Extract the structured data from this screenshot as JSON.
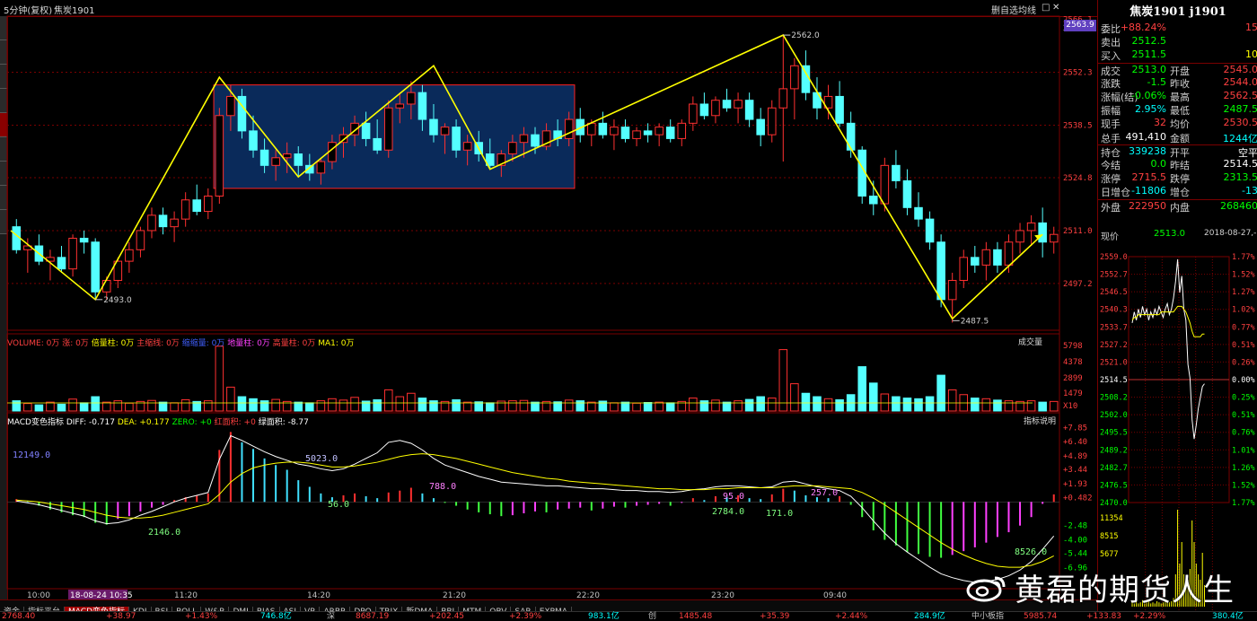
{
  "topbar": {
    "period": "5分钟(复权)",
    "contract": "焦炭1901",
    "right_tools": [
      "删自选",
      "均线",
      "□",
      "✕"
    ]
  },
  "right_axis_labels": [
    "2566.1",
    "2563.9",
    "2552.3",
    "2538.5",
    "2524.8",
    "2511.0",
    "2497.2"
  ],
  "volume_axis_labels": [
    "5798",
    "4378",
    "2899",
    "1479",
    "X10"
  ],
  "macd_axis_labels": [
    "+7.85",
    "+6.40",
    "+4.89",
    "+3.44",
    "+1.93",
    "+0.482",
    "-2.48",
    "-4.00",
    "-5.44",
    "-6.96"
  ],
  "time_axis_labels": [
    "10:00",
    "18-08-24 10:35",
    "11:20",
    "14:20",
    "21:20",
    "22:20",
    "23:20",
    "09:40"
  ],
  "volume_pane": {
    "legend": [
      "VOLUME: 0万",
      "涨: 0万",
      "倍量柱: 0万",
      "主缩线: 0万",
      "缩缩量: 0万",
      "地量柱: 0万",
      "高量柱: 0万",
      "MA1: 0万"
    ],
    "button": "成交量"
  },
  "macd_pane": {
    "legend": [
      "MACD变色指标 DIFF: -0.717",
      "DEA: +0.177",
      "ZERO: +0",
      "红面积: +0",
      "绿面积: -8.77"
    ],
    "button": "指标说明",
    "annotations": [
      "12149.0",
      "2146.0",
      "56.0",
      "5023.0",
      "788.0",
      "2784.0",
      "95.0",
      "171.0",
      "257.0",
      "8526.0"
    ]
  },
  "price_labels": {
    "low1": "2493.0",
    "high": "2562.0",
    "low2": "2487.5"
  },
  "quote": {
    "title": "焦炭1901 j1901",
    "current_price_tag": "2563.9",
    "rows": [
      {
        "k": "委比",
        "v1": "+88.24%",
        "c1": "#ff4040",
        "k2": "",
        "v2": "15",
        "c2": "#ff4040"
      },
      {
        "k": "卖出",
        "v1": "2512.5",
        "c1": "#00ff00",
        "k2": "",
        "v2": "",
        "c2": "#ff4040"
      },
      {
        "k": "买入",
        "v1": "2511.5",
        "c1": "#00ff00",
        "k2": "",
        "v2": "10",
        "c2": "#ffff00"
      },
      {
        "k": "成交",
        "v1": "2513.0",
        "c1": "#00ff00",
        "k2": "开盘",
        "v2": "2545.0",
        "c2": "#ff4040"
      },
      {
        "k": "涨跌",
        "v1": "-1.5",
        "c1": "#00ff00",
        "k2": "昨收",
        "v2": "2544.0",
        "c2": "#ff4040"
      },
      {
        "k": "涨幅(结)",
        "v1": "-0.06%",
        "c1": "#00ff00",
        "k2": "最高",
        "v2": "2562.5",
        "c2": "#ff4040"
      },
      {
        "k": "振幅",
        "v1": "2.95%",
        "c1": "#00ffff",
        "k2": "最低",
        "v2": "2487.5",
        "c2": "#00ff00"
      },
      {
        "k": "现手",
        "v1": "32",
        "c1": "#ff4040",
        "k2": "均价",
        "v2": "2530.5",
        "c2": "#ff4040"
      },
      {
        "k": "总手",
        "v1": "491,410",
        "c1": "#ffffff",
        "k2": "金额",
        "v2": "1244亿",
        "c2": "#00ffff"
      },
      {
        "k": "持仓",
        "v1": "339238",
        "c1": "#00ffff",
        "k2": "开平",
        "v2": "空平",
        "c2": "#ffffff"
      },
      {
        "k": "今结",
        "v1": "0.0",
        "c1": "#00ff00",
        "k2": "昨结",
        "v2": "2514.5",
        "c2": "#ffffff"
      },
      {
        "k": "涨停",
        "v1": "2715.5",
        "c1": "#ff4040",
        "k2": "跌停",
        "v2": "2313.5",
        "c2": "#00ff00"
      },
      {
        "k": "日增仓",
        "v1": "-11806",
        "c1": "#00ffff",
        "k2": "增仓",
        "v2": "-13",
        "c2": "#00ffff"
      },
      {
        "k": "外盘",
        "v1": "222950",
        "c1": "#ff4040",
        "k2": "内盘",
        "v2": "268460",
        "c2": "#00ff00"
      }
    ],
    "now_label": "现价",
    "now_price": "2513.0",
    "now_time": "2018-08-27,-",
    "mini_left_labels": [
      "2559.0",
      "2552.7",
      "2546.5",
      "2540.3",
      "2533.7",
      "2527.2",
      "2521.0",
      "2514.5",
      "2508.2",
      "2502.0",
      "2495.5",
      "2489.2",
      "2482.7",
      "2476.5",
      "2470.0",
      "11354",
      "8515",
      "5677"
    ],
    "mini_right_labels": [
      "1.77%",
      "1.52%",
      "1.27%",
      "1.02%",
      "0.77%",
      "0.51%",
      "0.26%",
      "0.00%",
      "0.25%",
      "0.51%",
      "0.76%",
      "1.01%",
      "1.26%",
      "1.52%",
      "1.77%"
    ]
  },
  "tabs": [
    "资金",
    "指标平台",
    "MACD变色指标",
    "KDJ",
    "RSI",
    "BOLL",
    "W&R",
    "DMI",
    "BIAS",
    "ASI",
    "VR",
    "ARBR",
    "DPO",
    "TRIX",
    "新DMA",
    "BBI",
    "MTM",
    "OBV",
    "SAR",
    "EXPMA"
  ],
  "status": [
    {
      "t": "2768.40",
      "c": "#ff4040"
    },
    {
      "t": "+38.97",
      "c": "#ff4040"
    },
    {
      "t": "+1.43%",
      "c": "#ff4040"
    },
    {
      "t": "746.8亿",
      "c": "#00ffff"
    },
    {
      "t": "深",
      "c": "#c0c0c0"
    },
    {
      "t": "8687.19",
      "c": "#ff4040"
    },
    {
      "t": "+202.45",
      "c": "#ff4040"
    },
    {
      "t": "+2.39%",
      "c": "#ff4040"
    },
    {
      "t": "983.1亿",
      "c": "#00ffff"
    },
    {
      "t": "创",
      "c": "#c0c0c0"
    },
    {
      "t": "1485.48",
      "c": "#ff4040"
    },
    {
      "t": "+35.39",
      "c": "#ff4040"
    },
    {
      "t": "+2.44%",
      "c": "#ff4040"
    },
    {
      "t": "284.9亿",
      "c": "#00ffff"
    },
    {
      "t": "中小板指",
      "c": "#c0c0c0"
    },
    {
      "t": "5985.74",
      "c": "#ff4040"
    },
    {
      "t": "+133.83",
      "c": "#ff4040"
    },
    {
      "t": "+2.29%",
      "c": "#ff4040"
    },
    {
      "t": "380.4亿",
      "c": "#00ffff"
    }
  ],
  "watermark": "黄磊的期货人生",
  "colors": {
    "up": "#ff3030",
    "down": "#54ffff",
    "zigzag": "#ffff00",
    "box_fill": "#0a2a5a",
    "box_border": "#ff2020",
    "grid": "#7a0000"
  },
  "chart_data": {
    "type": "candlestick",
    "ylim": [
      2485,
      2566
    ],
    "ohlc": [
      [
        2512,
        2514,
        2505,
        2506
      ],
      [
        2506,
        2509,
        2500,
        2507
      ],
      [
        2507,
        2510,
        2502,
        2503
      ],
      [
        2503,
        2506,
        2498,
        2504
      ],
      [
        2504,
        2507,
        2500,
        2501
      ],
      [
        2501,
        2510,
        2499,
        2509
      ],
      [
        2509,
        2511,
        2505,
        2508
      ],
      [
        2508,
        2509,
        2493,
        2495
      ],
      [
        2495,
        2499,
        2493,
        2498
      ],
      [
        2498,
        2504,
        2496,
        2503
      ],
      [
        2503,
        2508,
        2500,
        2506
      ],
      [
        2506,
        2512,
        2504,
        2511
      ],
      [
        2511,
        2517,
        2509,
        2515
      ],
      [
        2515,
        2517,
        2510,
        2512
      ],
      [
        2512,
        2516,
        2508,
        2514
      ],
      [
        2514,
        2521,
        2512,
        2519
      ],
      [
        2519,
        2523,
        2515,
        2516
      ],
      [
        2516,
        2522,
        2514,
        2520
      ],
      [
        2520,
        2543,
        2518,
        2541
      ],
      [
        2541,
        2549,
        2537,
        2546
      ],
      [
        2546,
        2548,
        2535,
        2537
      ],
      [
        2537,
        2541,
        2530,
        2532
      ],
      [
        2532,
        2535,
        2526,
        2528
      ],
      [
        2528,
        2532,
        2524,
        2530
      ],
      [
        2530,
        2534,
        2526,
        2531
      ],
      [
        2531,
        2533,
        2525,
        2528
      ],
      [
        2528,
        2531,
        2524,
        2526
      ],
      [
        2526,
        2530,
        2523,
        2529
      ],
      [
        2529,
        2536,
        2527,
        2534
      ],
      [
        2534,
        2538,
        2530,
        2536
      ],
      [
        2536,
        2541,
        2533,
        2539
      ],
      [
        2539,
        2542,
        2533,
        2535
      ],
      [
        2535,
        2540,
        2531,
        2532
      ],
      [
        2532,
        2545,
        2530,
        2543
      ],
      [
        2543,
        2547,
        2539,
        2544
      ],
      [
        2544,
        2550,
        2540,
        2547
      ],
      [
        2547,
        2549,
        2537,
        2540
      ],
      [
        2540,
        2544,
        2534,
        2536
      ],
      [
        2536,
        2539,
        2531,
        2538
      ],
      [
        2538,
        2540,
        2530,
        2532
      ],
      [
        2532,
        2536,
        2528,
        2534
      ],
      [
        2534,
        2537,
        2529,
        2531
      ],
      [
        2531,
        2535,
        2527,
        2528
      ],
      [
        2528,
        2532,
        2525,
        2531
      ],
      [
        2531,
        2536,
        2529,
        2534
      ],
      [
        2534,
        2538,
        2530,
        2536
      ],
      [
        2536,
        2538,
        2531,
        2533
      ],
      [
        2533,
        2539,
        2532,
        2537
      ],
      [
        2537,
        2540,
        2533,
        2535
      ],
      [
        2535,
        2542,
        2533,
        2540
      ],
      [
        2540,
        2543,
        2534,
        2536
      ],
      [
        2536,
        2540,
        2533,
        2539
      ],
      [
        2539,
        2542,
        2535,
        2536
      ],
      [
        2536,
        2540,
        2532,
        2538
      ],
      [
        2538,
        2540,
        2534,
        2535
      ],
      [
        2535,
        2538,
        2533,
        2537
      ],
      [
        2537,
        2539,
        2534,
        2536
      ],
      [
        2536,
        2539,
        2533,
        2538
      ],
      [
        2538,
        2540,
        2534,
        2535
      ],
      [
        2535,
        2540,
        2533,
        2539
      ],
      [
        2539,
        2546,
        2537,
        2544
      ],
      [
        2544,
        2547,
        2540,
        2541
      ],
      [
        2541,
        2546,
        2539,
        2545
      ],
      [
        2545,
        2548,
        2542,
        2543
      ],
      [
        2543,
        2547,
        2539,
        2545
      ],
      [
        2545,
        2547,
        2538,
        2540
      ],
      [
        2540,
        2543,
        2533,
        2536
      ],
      [
        2536,
        2545,
        2534,
        2543
      ],
      [
        2543,
        2562,
        2529,
        2548
      ],
      [
        2548,
        2556,
        2540,
        2554
      ],
      [
        2554,
        2558,
        2545,
        2547
      ],
      [
        2547,
        2551,
        2540,
        2543
      ],
      [
        2543,
        2549,
        2540,
        2546
      ],
      [
        2546,
        2550,
        2538,
        2539
      ],
      [
        2539,
        2542,
        2530,
        2532
      ],
      [
        2532,
        2533,
        2518,
        2520
      ],
      [
        2520,
        2524,
        2515,
        2518
      ],
      [
        2518,
        2530,
        2516,
        2528
      ],
      [
        2528,
        2532,
        2522,
        2524
      ],
      [
        2524,
        2527,
        2515,
        2517
      ],
      [
        2517,
        2521,
        2512,
        2514
      ],
      [
        2514,
        2516,
        2506,
        2508
      ],
      [
        2508,
        2510,
        2491,
        2493
      ],
      [
        2493,
        2500,
        2487,
        2498
      ],
      [
        2498,
        2506,
        2496,
        2504
      ],
      [
        2504,
        2507,
        2500,
        2502
      ],
      [
        2502,
        2508,
        2498,
        2506
      ],
      [
        2506,
        2508,
        2500,
        2502
      ],
      [
        2502,
        2510,
        2500,
        2508
      ],
      [
        2508,
        2513,
        2505,
        2511
      ],
      [
        2511,
        2515,
        2507,
        2513
      ],
      [
        2513,
        2517,
        2504,
        2508
      ],
      [
        2508,
        2512,
        2505,
        2510
      ]
    ],
    "price_zigzag": [
      [
        0,
        2511
      ],
      [
        7,
        2493
      ],
      [
        18,
        2551
      ],
      [
        25,
        2525
      ],
      [
        37,
        2554
      ],
      [
        42,
        2527
      ],
      [
        68,
        2562
      ],
      [
        83,
        2488
      ],
      [
        91,
        2510
      ]
    ],
    "volume": [
      300,
      220,
      180,
      260,
      200,
      350,
      240,
      420,
      260,
      300,
      230,
      280,
      310,
      260,
      240,
      330,
      280,
      300,
      1900,
      700,
      420,
      360,
      300,
      340,
      280,
      260,
      240,
      300,
      360,
      320,
      400,
      290,
      330,
      620,
      420,
      520,
      380,
      300,
      280,
      330,
      260,
      270,
      240,
      290,
      300,
      310,
      260,
      280,
      270,
      320,
      300,
      260,
      290,
      240,
      260,
      230,
      250,
      260,
      240,
      280,
      380,
      300,
      320,
      260,
      300,
      340,
      420,
      380,
      1800,
      800,
      520,
      420,
      360,
      330,
      480,
      1300,
      820,
      500,
      420,
      380,
      360,
      420,
      1050,
      620,
      480,
      380,
      360,
      320,
      300,
      280,
      300,
      260,
      280
    ],
    "macd": [
      0.3,
      0.1,
      -0.4,
      -0.8,
      -1.1,
      -1.4,
      -1.6,
      -2.2,
      -2.4,
      -1.8,
      -1.5,
      -1.0,
      -0.6,
      -0.3,
      0.2,
      0.5,
      0.7,
      0.9,
      5.5,
      7.4,
      6.3,
      5.6,
      4.6,
      3.9,
      3.4,
      2.3,
      1.6,
      0.9,
      0.5,
      0.7,
      0.9,
      0.6,
      0.4,
      1.0,
      1.2,
      1.5,
      0.9,
      0.4,
      -0.1,
      -0.4,
      -0.8,
      -1.1,
      -1.3,
      -1.5,
      -1.4,
      -1.2,
      -1.0,
      -1.1,
      -0.8,
      -0.7,
      -0.6,
      -0.9,
      -0.7,
      -0.5,
      -0.6,
      -0.4,
      -0.3,
      -0.2,
      -0.4,
      -0.1,
      0.4,
      0.2,
      0.6,
      0.5,
      0.7,
      0.4,
      0.3,
      0.8,
      1.4,
      1.2,
      0.7,
      0.5,
      0.4,
      0.6,
      -0.3,
      -1.6,
      -3.0,
      -4.0,
      -4.6,
      -5.3,
      -5.5,
      -5.8,
      -5.9,
      -5.6,
      -5.2,
      -4.8,
      -4.3,
      -3.7,
      -3.2,
      -2.5,
      -1.6,
      -0.2,
      0.8
    ],
    "diff": [
      0.1,
      -0.1,
      -0.3,
      -0.6,
      -0.9,
      -1.2,
      -1.5,
      -2.0,
      -2.3,
      -2.2,
      -1.9,
      -1.4,
      -1.0,
      -0.5,
      0.0,
      0.4,
      0.7,
      1.0,
      4.5,
      7.0,
      6.5,
      5.9,
      5.3,
      4.8,
      4.4,
      4.0,
      3.8,
      3.5,
      3.3,
      3.5,
      4.0,
      4.6,
      5.2,
      6.3,
      6.5,
      6.2,
      5.5,
      4.6,
      3.9,
      3.5,
      3.1,
      2.7,
      2.4,
      2.1,
      2.0,
      1.9,
      1.8,
      1.7,
      1.7,
      1.6,
      1.5,
      1.4,
      1.4,
      1.3,
      1.2,
      1.2,
      1.1,
      1.1,
      1.0,
      1.1,
      1.3,
      1.4,
      1.6,
      1.7,
      1.7,
      1.6,
      1.5,
      1.6,
      2.1,
      2.2,
      1.9,
      1.6,
      1.4,
      1.2,
      0.6,
      -0.6,
      -2.0,
      -3.3,
      -4.4,
      -5.3,
      -6.1,
      -6.9,
      -7.6,
      -8.0,
      -8.3,
      -8.5,
      -8.4,
      -8.2,
      -7.8,
      -7.2,
      -6.3,
      -5.0,
      -3.6
    ],
    "dea": [
      0.2,
      0.1,
      0.0,
      -0.2,
      -0.4,
      -0.6,
      -0.8,
      -1.1,
      -1.4,
      -1.6,
      -1.7,
      -1.7,
      -1.6,
      -1.4,
      -1.1,
      -0.8,
      -0.5,
      -0.2,
      0.8,
      2.1,
      3.0,
      3.6,
      3.9,
      4.1,
      4.2,
      4.2,
      4.1,
      3.9,
      3.7,
      3.7,
      3.8,
      4.0,
      4.2,
      4.5,
      4.8,
      5.0,
      5.1,
      5.0,
      4.8,
      4.6,
      4.3,
      4.0,
      3.7,
      3.4,
      3.1,
      2.9,
      2.7,
      2.5,
      2.4,
      2.2,
      2.1,
      2.0,
      1.9,
      1.8,
      1.7,
      1.6,
      1.5,
      1.4,
      1.4,
      1.3,
      1.3,
      1.3,
      1.4,
      1.4,
      1.5,
      1.5,
      1.5,
      1.5,
      1.6,
      1.7,
      1.7,
      1.7,
      1.6,
      1.5,
      1.4,
      1.0,
      0.4,
      -0.3,
      -1.1,
      -1.9,
      -2.7,
      -3.5,
      -4.3,
      -5.0,
      -5.6,
      -6.1,
      -6.5,
      -6.8,
      -6.9,
      -6.9,
      -6.7,
      -6.3,
      -5.7
    ]
  }
}
